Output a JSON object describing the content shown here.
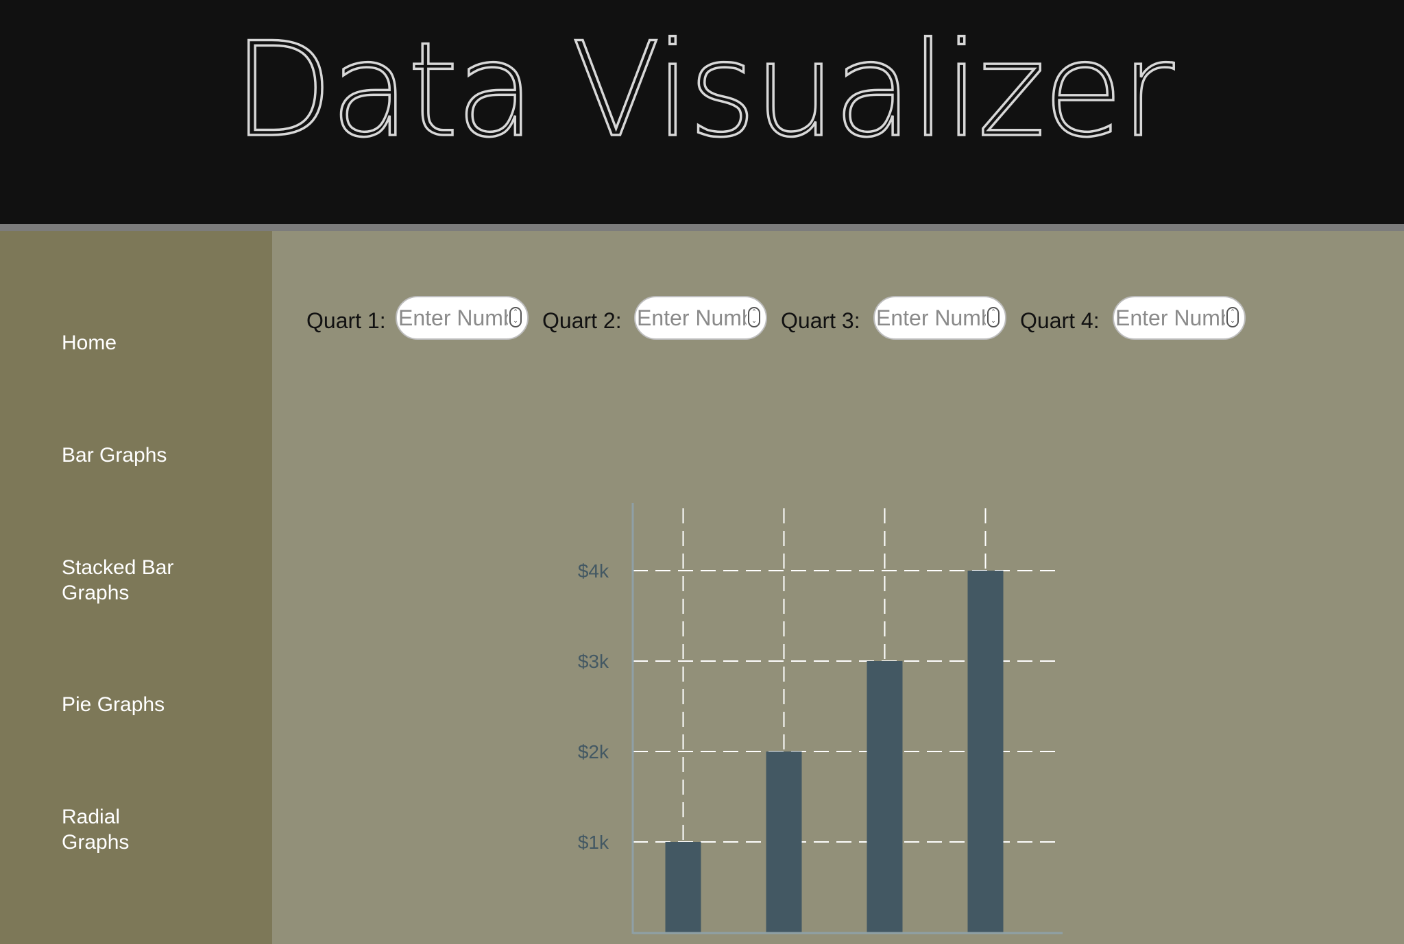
{
  "header": {
    "title": "Data Visualizer"
  },
  "sidebar": {
    "items": [
      {
        "label": "Home"
      },
      {
        "label": "Bar Graphs"
      },
      {
        "label": "Stacked Bar Graphs"
      },
      {
        "label": "Pie Graphs"
      },
      {
        "label": "Radial Graphs"
      }
    ]
  },
  "inputs": [
    {
      "label": "Quart 1:",
      "placeholder": "Enter Number",
      "value": ""
    },
    {
      "label": "Quart 2:",
      "placeholder": "Enter Number",
      "value": ""
    },
    {
      "label": "Quart 3:",
      "placeholder": "Enter Number",
      "value": ""
    },
    {
      "label": "Quart 4:",
      "placeholder": "Enter Number",
      "value": ""
    }
  ],
  "icons": {
    "spinner": "number-spinner-icon"
  },
  "colors": {
    "header_bg": "#111111",
    "sidebar_bg": "#7d7858",
    "main_bg": "#929079",
    "bar": "#435863",
    "tick_label": "#435863",
    "axis": "#8fa0a6",
    "grid": "#ffffff"
  },
  "chart_data": {
    "type": "bar",
    "categories": [
      "",
      "",
      "",
      ""
    ],
    "values": [
      1000,
      2000,
      3000,
      4000
    ],
    "title": "",
    "xlabel": "",
    "ylabel": "",
    "ylim": [
      0,
      4750
    ],
    "yticks": [
      1000,
      2000,
      3000,
      4000
    ],
    "ytick_labels": [
      "$1k",
      "$2k",
      "$3k",
      "$4k"
    ],
    "grid": true,
    "grid_style": "dashed"
  }
}
